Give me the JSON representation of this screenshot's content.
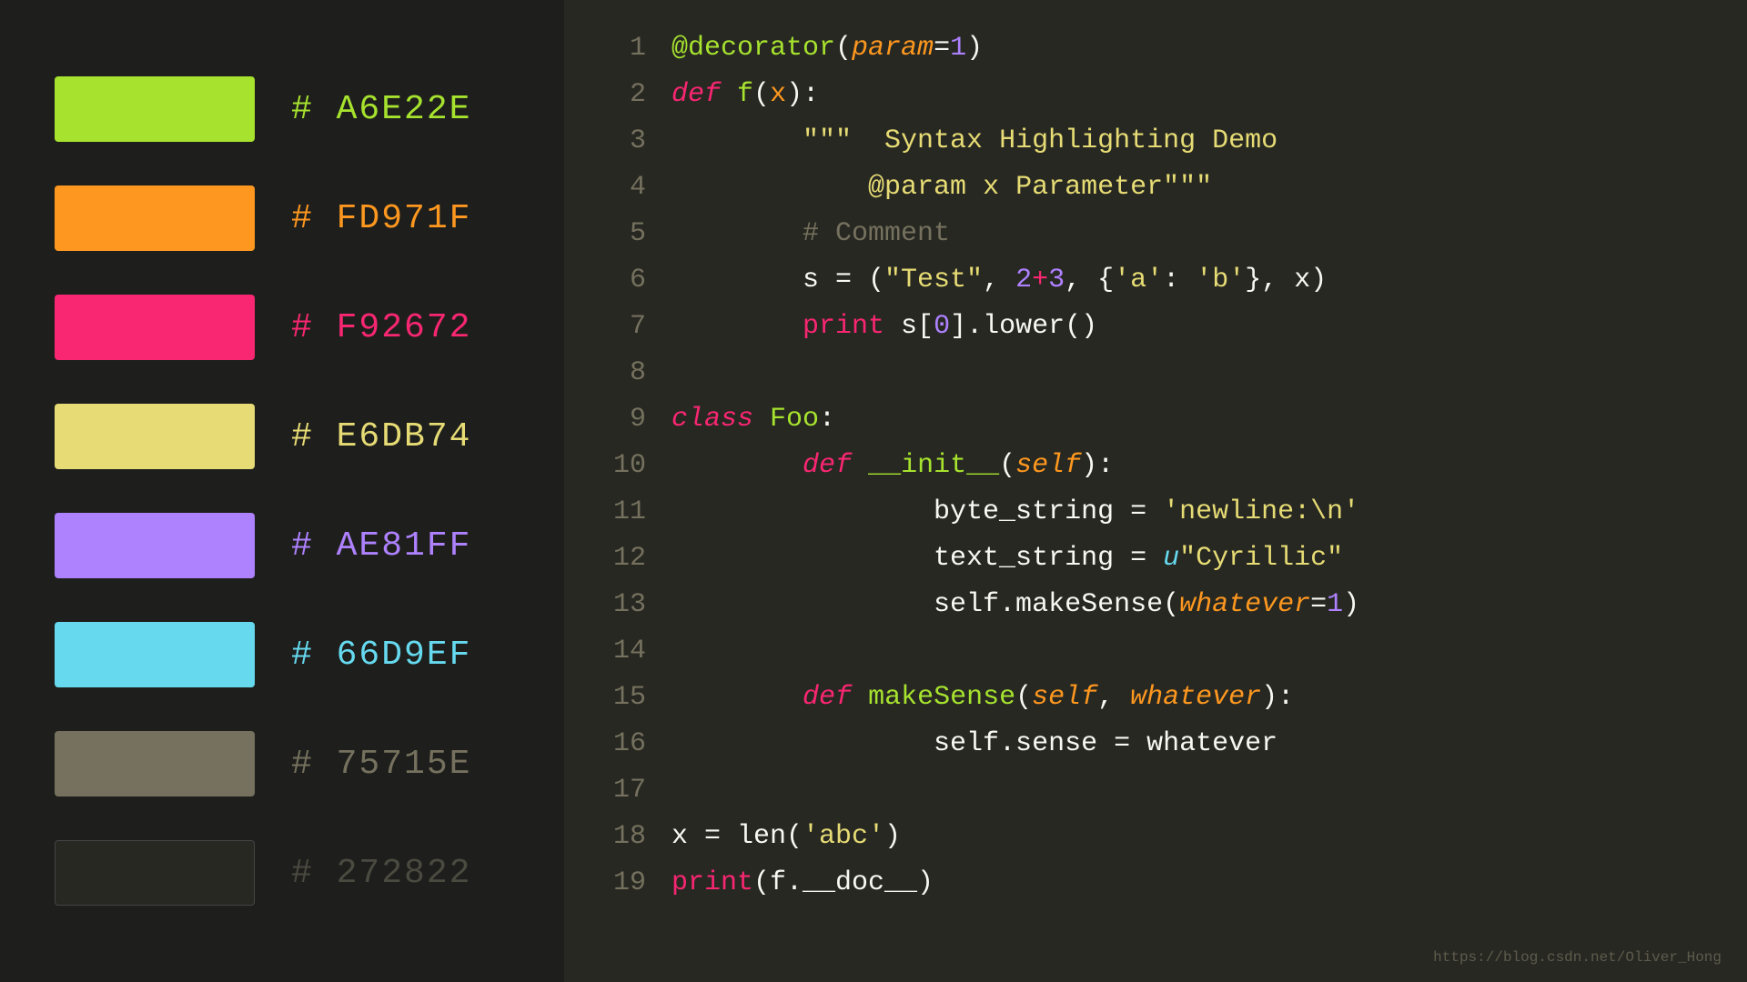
{
  "colors": [
    {
      "hex": "#A6E22E",
      "label": "# A6E22E",
      "label_color": "#a6e22e"
    },
    {
      "hex": "#FD971F",
      "label": "# FD971F",
      "label_color": "#fd971f"
    },
    {
      "hex": "#F92672",
      "label": "# F92672",
      "label_color": "#f92672"
    },
    {
      "hex": "#E6DB74",
      "label": "# E6DB74",
      "label_color": "#e6db74"
    },
    {
      "hex": "#AE81FF",
      "label": "# AE81FF",
      "label_color": "#ae81ff"
    },
    {
      "hex": "#66D9EF",
      "label": "# 66D9EF",
      "label_color": "#66d9ef"
    },
    {
      "hex": "#75715E",
      "label": "# 75715E",
      "label_color": "#75715e"
    },
    {
      "hex": "#272822",
      "label": "# 272822",
      "label_color": "#4a4a40"
    }
  ],
  "watermark": "https://blog.csdn.net/Oliver_Hong"
}
